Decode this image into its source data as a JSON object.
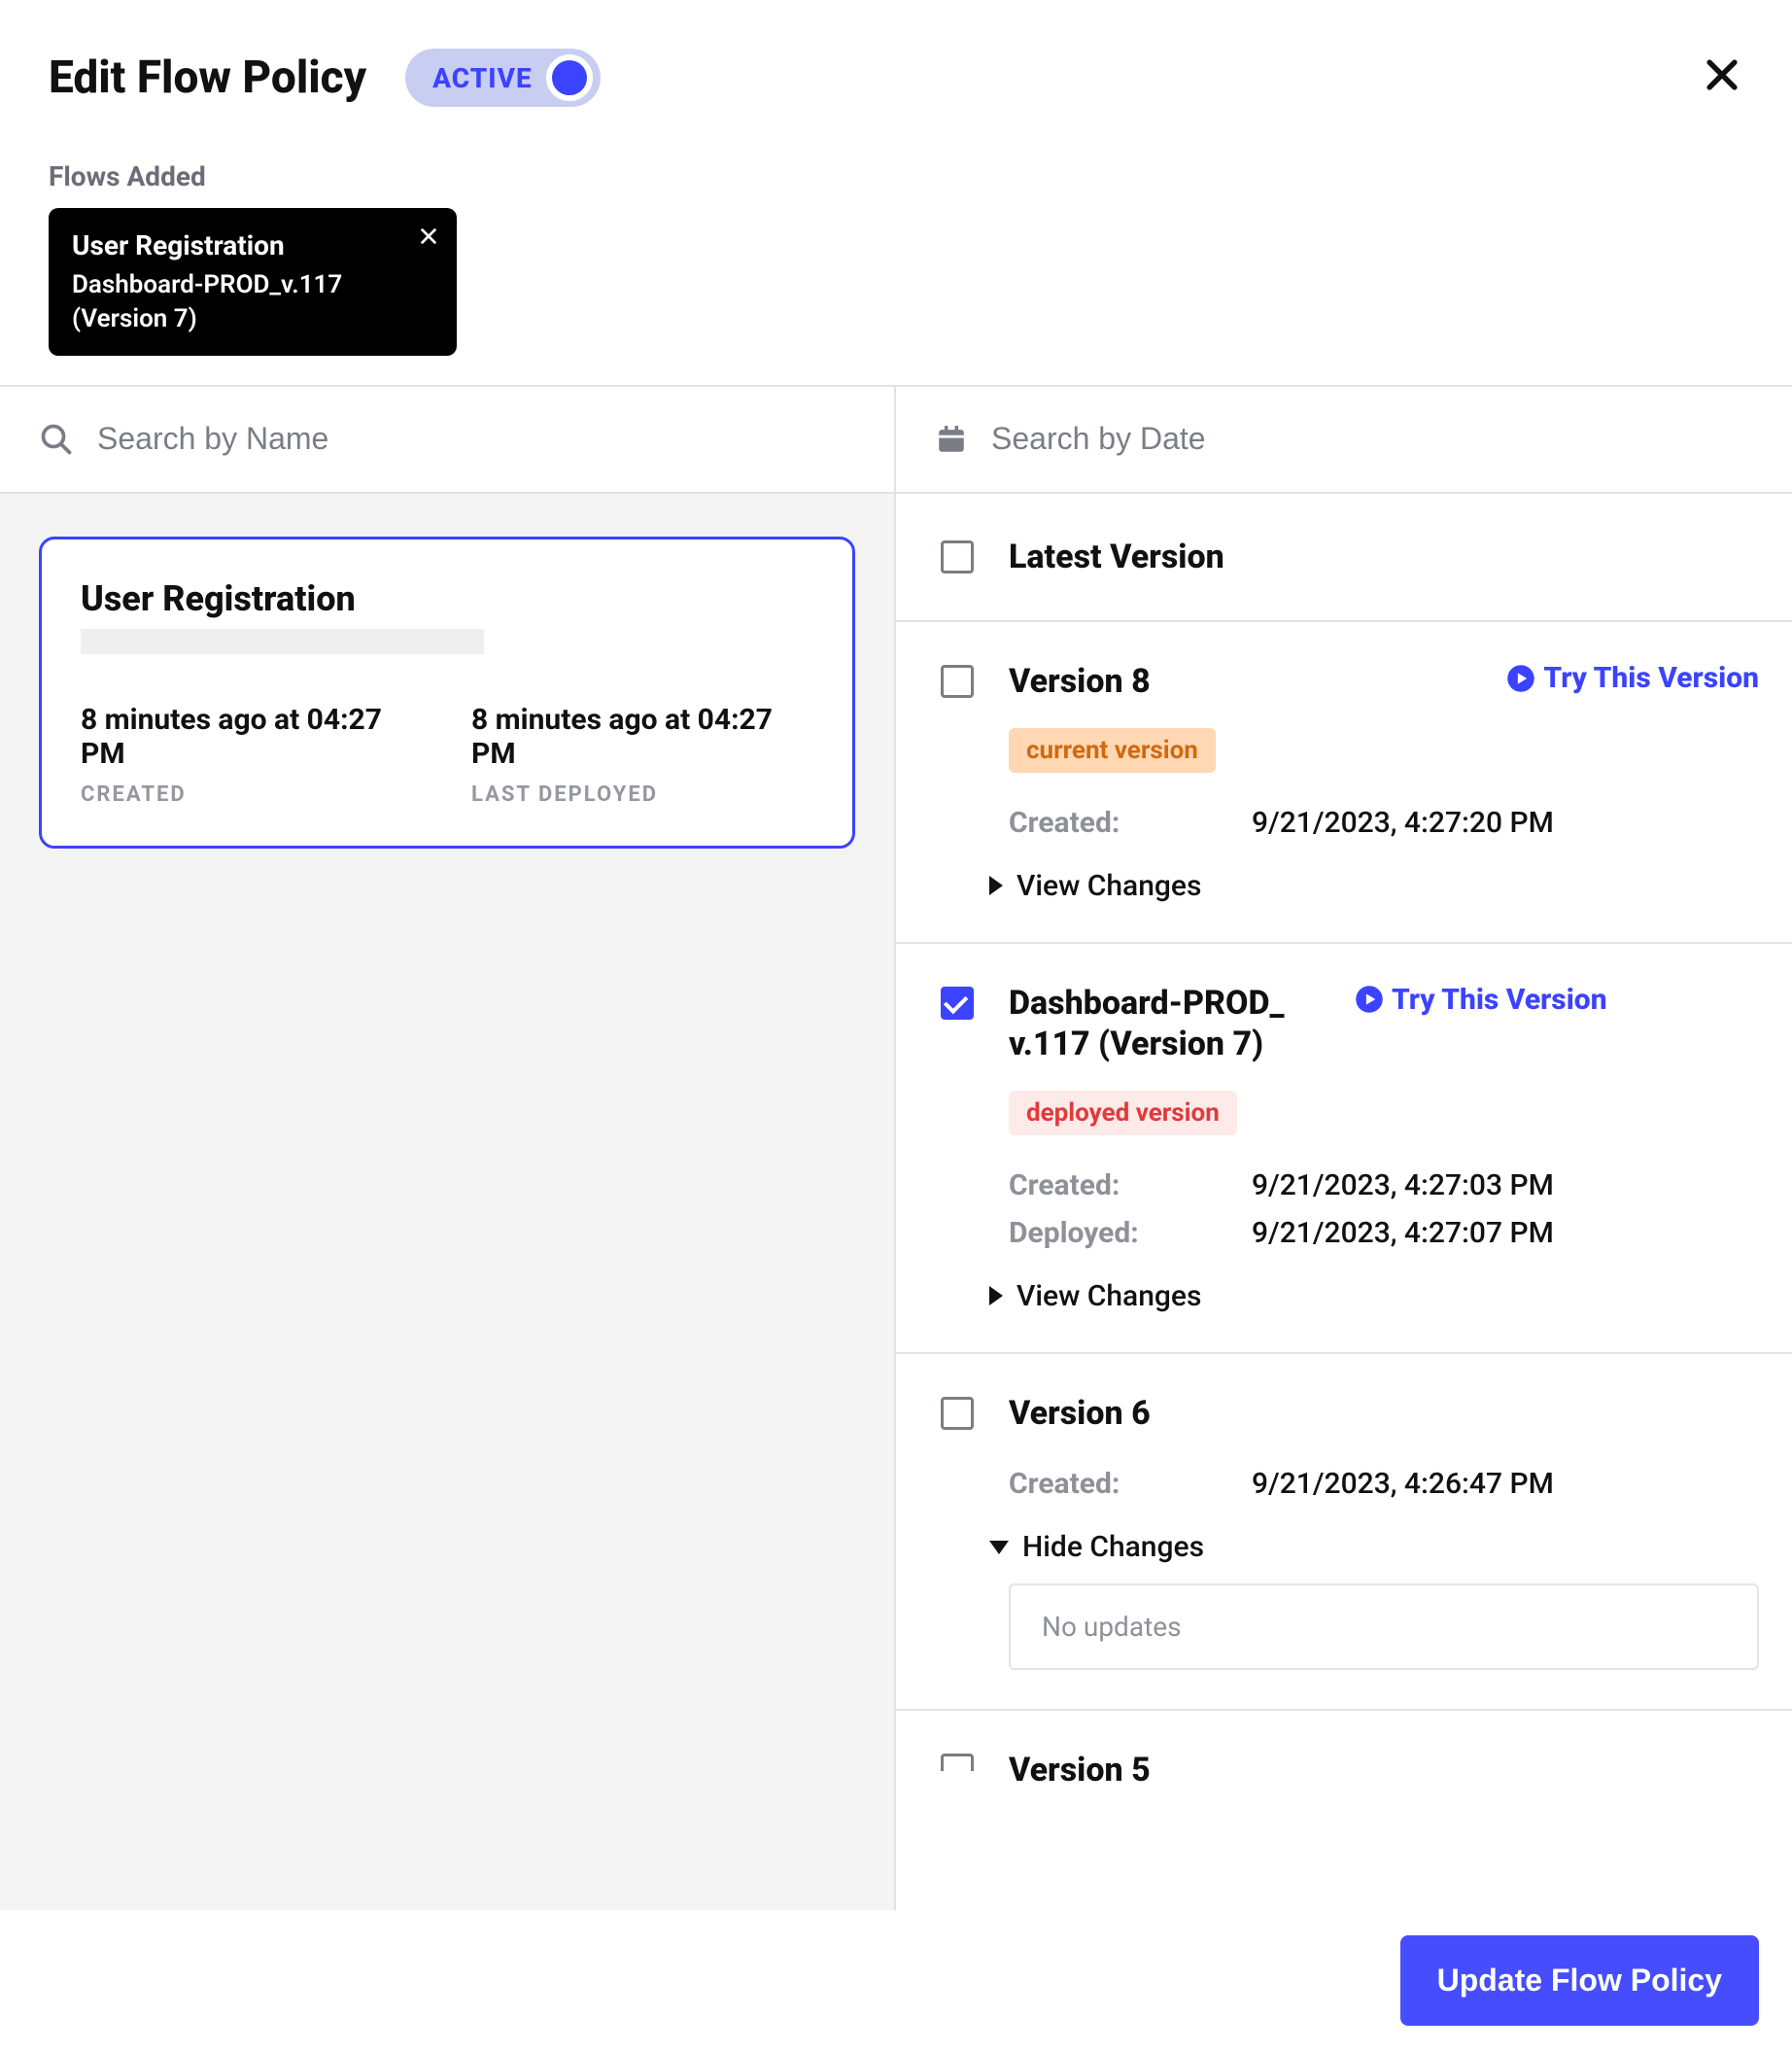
{
  "header": {
    "title": "Edit Flow Policy",
    "toggle_label": "ACTIVE",
    "flows_added_label": "Flows Added",
    "chip": {
      "title": "User Registration",
      "subtitle": "Dashboard-PROD_v.117 (Version 7)"
    }
  },
  "left": {
    "search_placeholder": "Search by Name",
    "card": {
      "title": "User Registration",
      "created_value": "8 minutes ago at 04:27 PM",
      "created_label": "CREATED",
      "deployed_value": "8 minutes ago at 04:27 PM",
      "deployed_label": "LAST DEPLOYED"
    }
  },
  "right": {
    "search_placeholder": "Search by Date",
    "latest_label": "Latest Version",
    "try_label": "Try This Version",
    "view_changes_label": "View Changes",
    "hide_changes_label": "Hide Changes",
    "no_updates_label": "No updates",
    "created_key": "Created:",
    "deployed_key": "Deployed:",
    "v8": {
      "title": "Version 8",
      "badge": "current version",
      "created": "9/21/2023, 4:27:20 PM"
    },
    "v7": {
      "title": "Dashboard-PROD_ v.117 (Version 7)",
      "badge": "deployed version",
      "created": "9/21/2023, 4:27:03 PM",
      "deployed": "9/21/2023, 4:27:07 PM"
    },
    "v6": {
      "title": "Version 6",
      "created": "9/21/2023, 4:26:47 PM"
    },
    "v5": {
      "title": "Version 5"
    }
  },
  "footer": {
    "button": "Update Flow Policy"
  }
}
